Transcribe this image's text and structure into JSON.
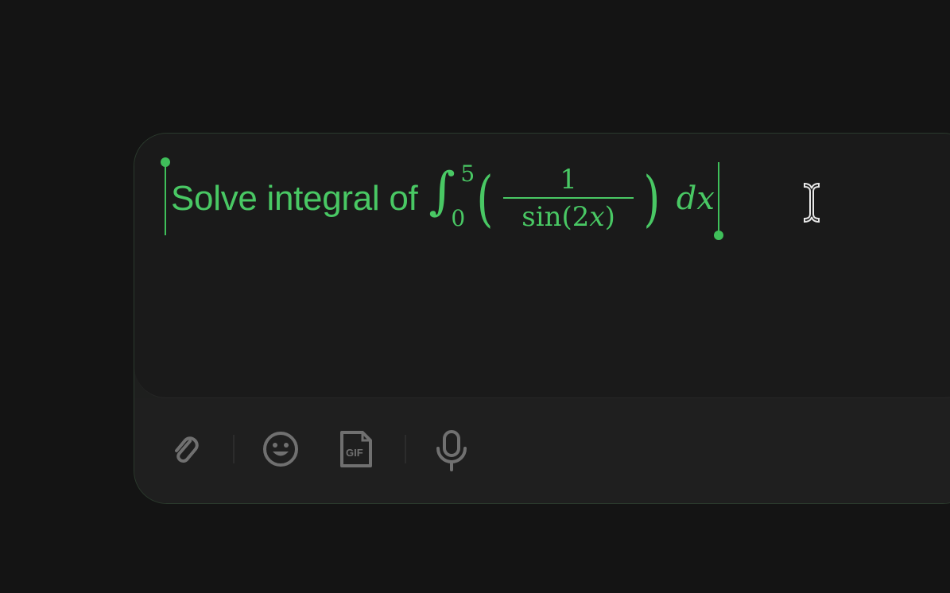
{
  "editor": {
    "text_prefix": "Solve integral of",
    "math": {
      "integral_sign": "∫",
      "upper_limit": "5",
      "lower_limit": "0",
      "open_paren": "(",
      "numerator": "1",
      "denominator_func": "sin(2",
      "denominator_var": "x",
      "denominator_close": ")",
      "close_paren": ")",
      "differential": "dx"
    }
  },
  "toolbar": {
    "buttons": [
      {
        "name": "attach",
        "icon": "paperclip-icon"
      },
      {
        "name": "emoji",
        "icon": "smiley-icon"
      },
      {
        "name": "gif",
        "icon": "gif-icon",
        "label": "GIF"
      },
      {
        "name": "voice",
        "icon": "microphone-icon"
      }
    ]
  },
  "colors": {
    "accent": "#49c864",
    "background": "#141414",
    "editor_bg": "#1a1a1a",
    "toolbar_bg": "#1f1f1f",
    "icon": "#6e6e6e"
  }
}
